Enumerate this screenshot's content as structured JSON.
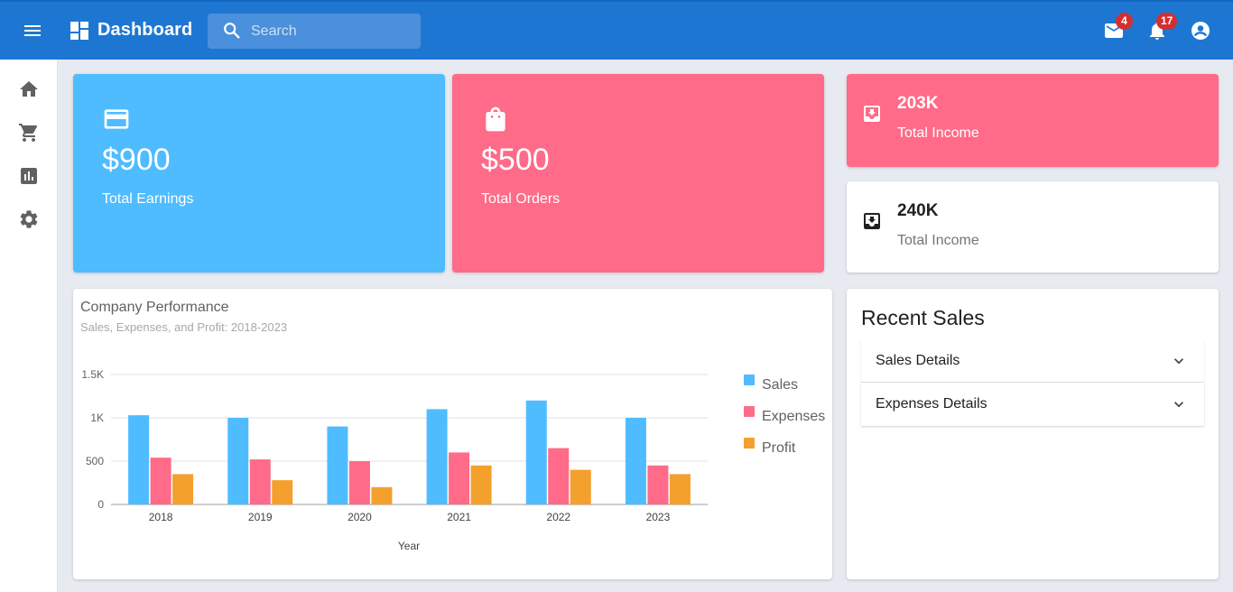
{
  "header": {
    "app_title": "Dashboard",
    "search_placeholder": "Search",
    "mail_badge": "4",
    "notification_badge": "17"
  },
  "sidebar": {
    "items": [
      {
        "icon": "home-icon"
      },
      {
        "icon": "cart-icon"
      },
      {
        "icon": "analytics-icon"
      },
      {
        "icon": "settings-icon"
      }
    ]
  },
  "stats": {
    "earnings": {
      "value": "$900",
      "label": "Total Earnings",
      "icon": "credit-card-icon",
      "color": "#4fbcff"
    },
    "orders": {
      "value": "$500",
      "label": "Total Orders",
      "icon": "shopping-bag-icon",
      "color": "#ff6b88"
    },
    "income_pink": {
      "value": "203K",
      "label": "Total Income",
      "icon": "inbox-icon",
      "color": "#ff6b88"
    },
    "income_white": {
      "value": "240K",
      "label": "Total Income",
      "icon": "inbox-icon"
    }
  },
  "performance": {
    "title": "Company Performance",
    "subtitle": "Sales, Expenses, and Profit: 2018-2023"
  },
  "chart_data": {
    "type": "bar",
    "categories": [
      "2018",
      "2019",
      "2020",
      "2021",
      "2022",
      "2023"
    ],
    "series": [
      {
        "name": "Sales",
        "values": [
          1030,
          1000,
          900,
          1100,
          1200,
          1000
        ],
        "color": "#4fbcff"
      },
      {
        "name": "Expenses",
        "values": [
          540,
          520,
          500,
          600,
          650,
          450
        ],
        "color": "#ff6b88"
      },
      {
        "name": "Profit",
        "values": [
          350,
          280,
          200,
          450,
          400,
          350
        ],
        "color": "#f4a02d"
      }
    ],
    "xlabel": "Year",
    "ylabel": "",
    "ylim": [
      0,
      1500
    ],
    "yticks": [
      "0",
      "500",
      "1K",
      "1.5K"
    ],
    "grid": true,
    "legend": "right"
  },
  "recent_sales": {
    "heading": "Recent Sales",
    "items": [
      {
        "label": "Sales Details"
      },
      {
        "label": "Expenses Details"
      }
    ]
  }
}
